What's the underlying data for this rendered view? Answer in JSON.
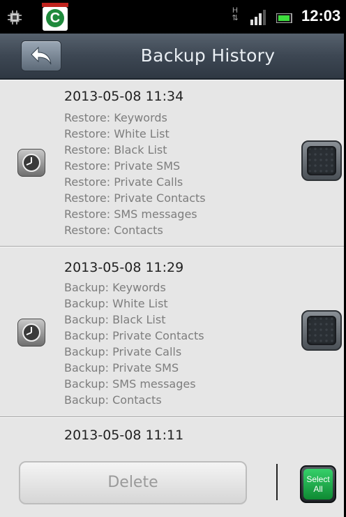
{
  "status_bar": {
    "time": "12:03",
    "network_type": "H",
    "icons": [
      "chip-icon",
      "app-notification-icon",
      "network-h-icon",
      "signal-icon",
      "battery-icon"
    ]
  },
  "header": {
    "title": "Backup History",
    "back_icon": "back-arrow-icon"
  },
  "records": [
    {
      "datetime": "2013-05-08 11:34",
      "items": [
        "Restore: Keywords",
        "Restore: White List",
        "Restore: Black List",
        "Restore: Private SMS",
        "Restore: Private Calls",
        "Restore: Private Contacts",
        "Restore: SMS messages",
        "Restore: Contacts"
      ],
      "checked": false
    },
    {
      "datetime": "2013-05-08 11:29",
      "items": [
        "Backup: Keywords",
        "Backup: White List",
        "Backup: Black List",
        "Backup: Private Contacts",
        "Backup: Private Calls",
        "Backup: Private SMS",
        "Backup: SMS messages",
        "Backup: Contacts"
      ],
      "checked": false
    },
    {
      "datetime": "2013-05-08 11:11",
      "items": []
    }
  ],
  "footer": {
    "delete_label": "Delete",
    "select_all_line1": "Select",
    "select_all_line2": "All"
  },
  "colors": {
    "titlebar": "#3d4753",
    "list_background": "#e6e6e6",
    "select_all_green": "#1fae4c"
  }
}
